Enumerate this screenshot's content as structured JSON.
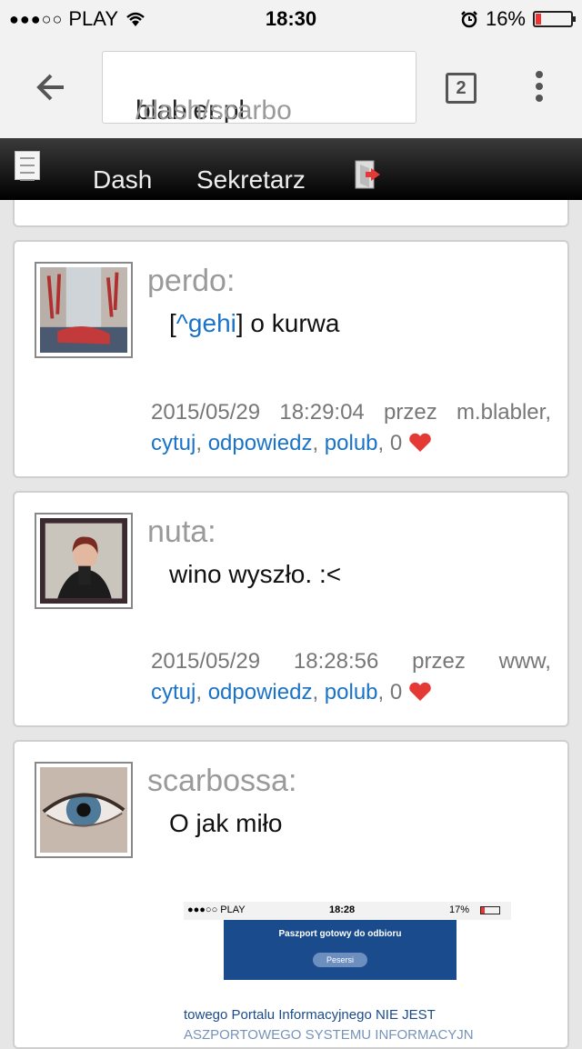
{
  "status_bar": {
    "signal": "●●●○○",
    "carrier": "PLAY",
    "time": "18:30",
    "battery": "16%",
    "battery_level": 0.16
  },
  "browser": {
    "url_host": "blabler.pl",
    "url_path": "/dash/scarbo",
    "tab_count": "2"
  },
  "site_nav": {
    "links": [
      "Dash",
      "Sekretarz"
    ]
  },
  "posts": [
    {
      "author": "perdo:",
      "mention": "^gehi",
      "message": " o kurwa",
      "date": "2015/05/29",
      "time": "18:29:04",
      "by_label": "przez",
      "via": "m.blabler,",
      "actions": [
        "cytuj",
        "odpowiedz",
        "polub"
      ],
      "likes": "0"
    },
    {
      "author": "nuta:",
      "message": "wino wyszło. :<",
      "date": "2015/05/29",
      "time": "18:28:56",
      "by_label": "przez",
      "via": "www,",
      "actions": [
        "cytuj",
        "odpowiedz",
        "polub"
      ],
      "likes": "0"
    },
    {
      "author": "scarbossa:",
      "message": "O jak miło",
      "embedded_image": {
        "carrier": "●●●○○ PLAY",
        "time": "18:28",
        "battery": "17%",
        "banner_title": "Paszport gotowy do odbioru",
        "banner_button": "Pesersi",
        "text_line1": "towego Portalu Informacyjnego NIE JEST",
        "text_line2": "ASZPORTOWEGO SYSTEMU INFORMACYJN"
      }
    }
  ],
  "colors": {
    "link": "#1a73c8",
    "author": "#9a9a9a",
    "nav_bg": "#000000",
    "heart": "#e53935"
  }
}
